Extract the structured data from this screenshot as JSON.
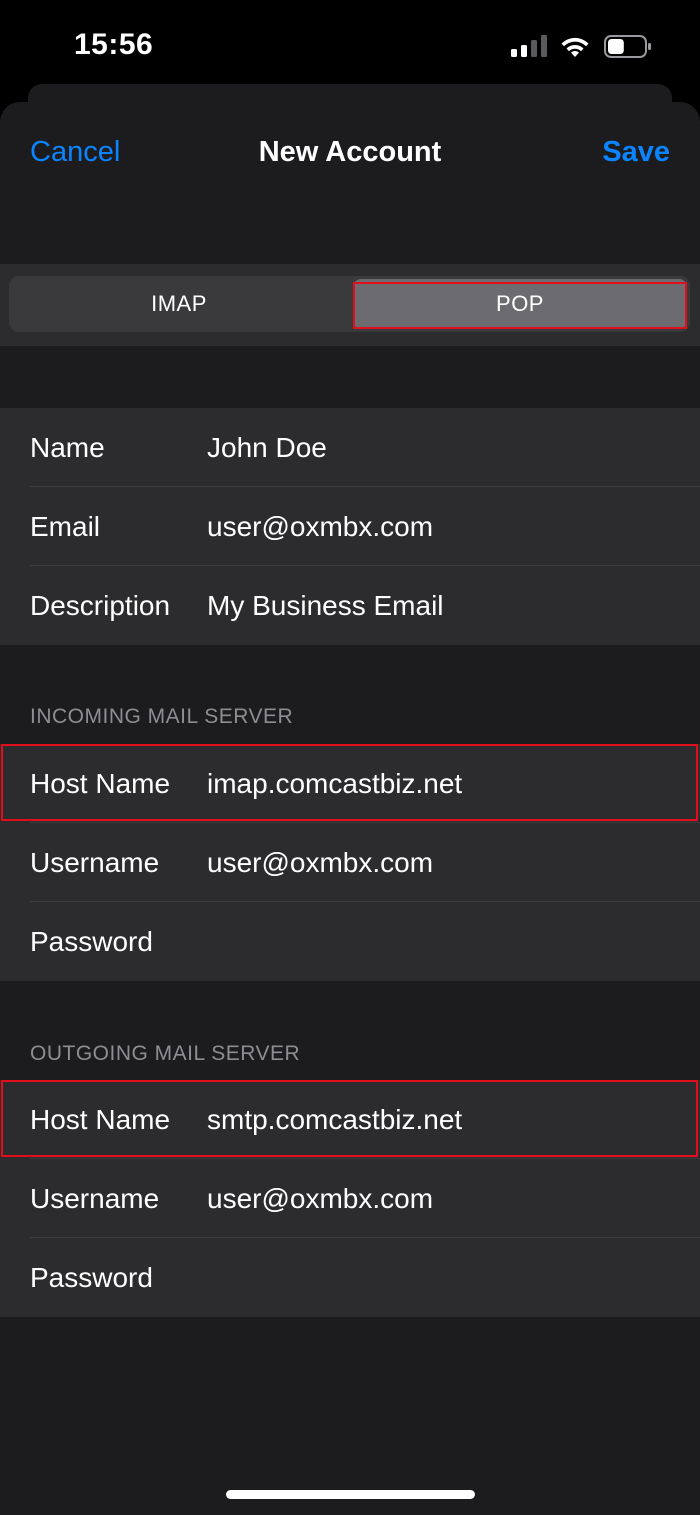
{
  "status_bar": {
    "time": "15:56",
    "icons": [
      "cellular-signal-icon",
      "wifi-icon",
      "battery-icon"
    ],
    "battery_level": 0.45
  },
  "nav": {
    "cancel_label": "Cancel",
    "title": "New Account",
    "save_label": "Save"
  },
  "segmented": {
    "options": [
      "IMAP",
      "POP"
    ],
    "selected": "POP"
  },
  "account": {
    "rows": [
      {
        "label": "Name",
        "value": "John Doe"
      },
      {
        "label": "Email",
        "value": "user@oxmbx.com"
      },
      {
        "label": "Description",
        "value": "My Business Email"
      }
    ]
  },
  "incoming": {
    "header": "INCOMING MAIL SERVER",
    "rows": [
      {
        "label": "Host Name",
        "value": "imap.comcastbiz.net"
      },
      {
        "label": "Username",
        "value": "user@oxmbx.com"
      },
      {
        "label": "Password",
        "value": ""
      }
    ]
  },
  "outgoing": {
    "header": "OUTGOING MAIL SERVER",
    "rows": [
      {
        "label": "Host Name",
        "value": "smtp.comcastbiz.net"
      },
      {
        "label": "Username",
        "value": "user@oxmbx.com"
      },
      {
        "label": "Password",
        "value": ""
      }
    ]
  },
  "colors": {
    "accent": "#0a84ff",
    "highlight": "#e10f1c",
    "background": "#1c1c1e",
    "cell": "#2c2c2e"
  }
}
